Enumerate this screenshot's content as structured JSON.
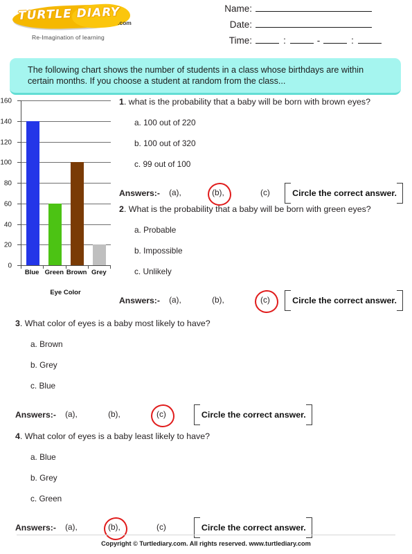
{
  "brand": {
    "logo_text": "TURTLE DIARY",
    "logo_suffix": ".com",
    "tagline": "Re-Imagination of learning"
  },
  "header_fields": {
    "name_label": "Name:",
    "date_label": "Date:",
    "time_label": "Time:",
    "time_sep_colon": ":",
    "time_sep_dash": "-"
  },
  "banner": {
    "text": "The following chart shows the number of students in a class whose birthdays are within certain months. If you choose a student at random from the class..."
  },
  "chart_data": {
    "type": "bar",
    "title": "",
    "categories": [
      "Blue",
      "Green",
      "Brown",
      "Grey"
    ],
    "values": [
      140,
      60,
      100,
      20
    ],
    "colors": [
      "#2436e8",
      "#4cc314",
      "#7a3b05",
      "#bfbfbf"
    ],
    "xlabel": "Eye Color",
    "ylabel": "",
    "ylim": [
      0,
      160
    ],
    "ytick_step": 20,
    "yticks": [
      0,
      20,
      40,
      60,
      80,
      100,
      120,
      140,
      160
    ],
    "grid": true,
    "legend": "none"
  },
  "circle_instruction": "Circle the correct answer.",
  "answers_label": "Answers:-",
  "choice_labels": [
    "(a),",
    "(b),",
    "(c)"
  ],
  "questions": [
    {
      "number": "1",
      "text": ". what is the probability that a baby will be born with brown eyes?",
      "options": [
        "a. 100 out of 220",
        "b. 100 out of 320",
        "c. 99 out of 100"
      ],
      "circled_index": 1
    },
    {
      "number": "2",
      "text": ". What is the probability that a baby will be born with green eyes?",
      "options": [
        "a. Probable",
        "b. Impossible",
        "c. Unlikely"
      ],
      "circled_index": 2
    },
    {
      "number": "3",
      "text": ". What color of eyes is a baby most likely to have?",
      "options": [
        "a. Brown",
        "b. Grey",
        "c. Blue"
      ],
      "circled_index": 2
    },
    {
      "number": "4",
      "text": ". What color of eyes is a baby least likely to have?",
      "options": [
        "a. Blue",
        "b. Grey",
        "c. Green"
      ],
      "circled_index": 1
    }
  ],
  "footer": {
    "copyright": "Copyright © Turtlediary.com. All rights reserved. www.turtlediary.com"
  }
}
